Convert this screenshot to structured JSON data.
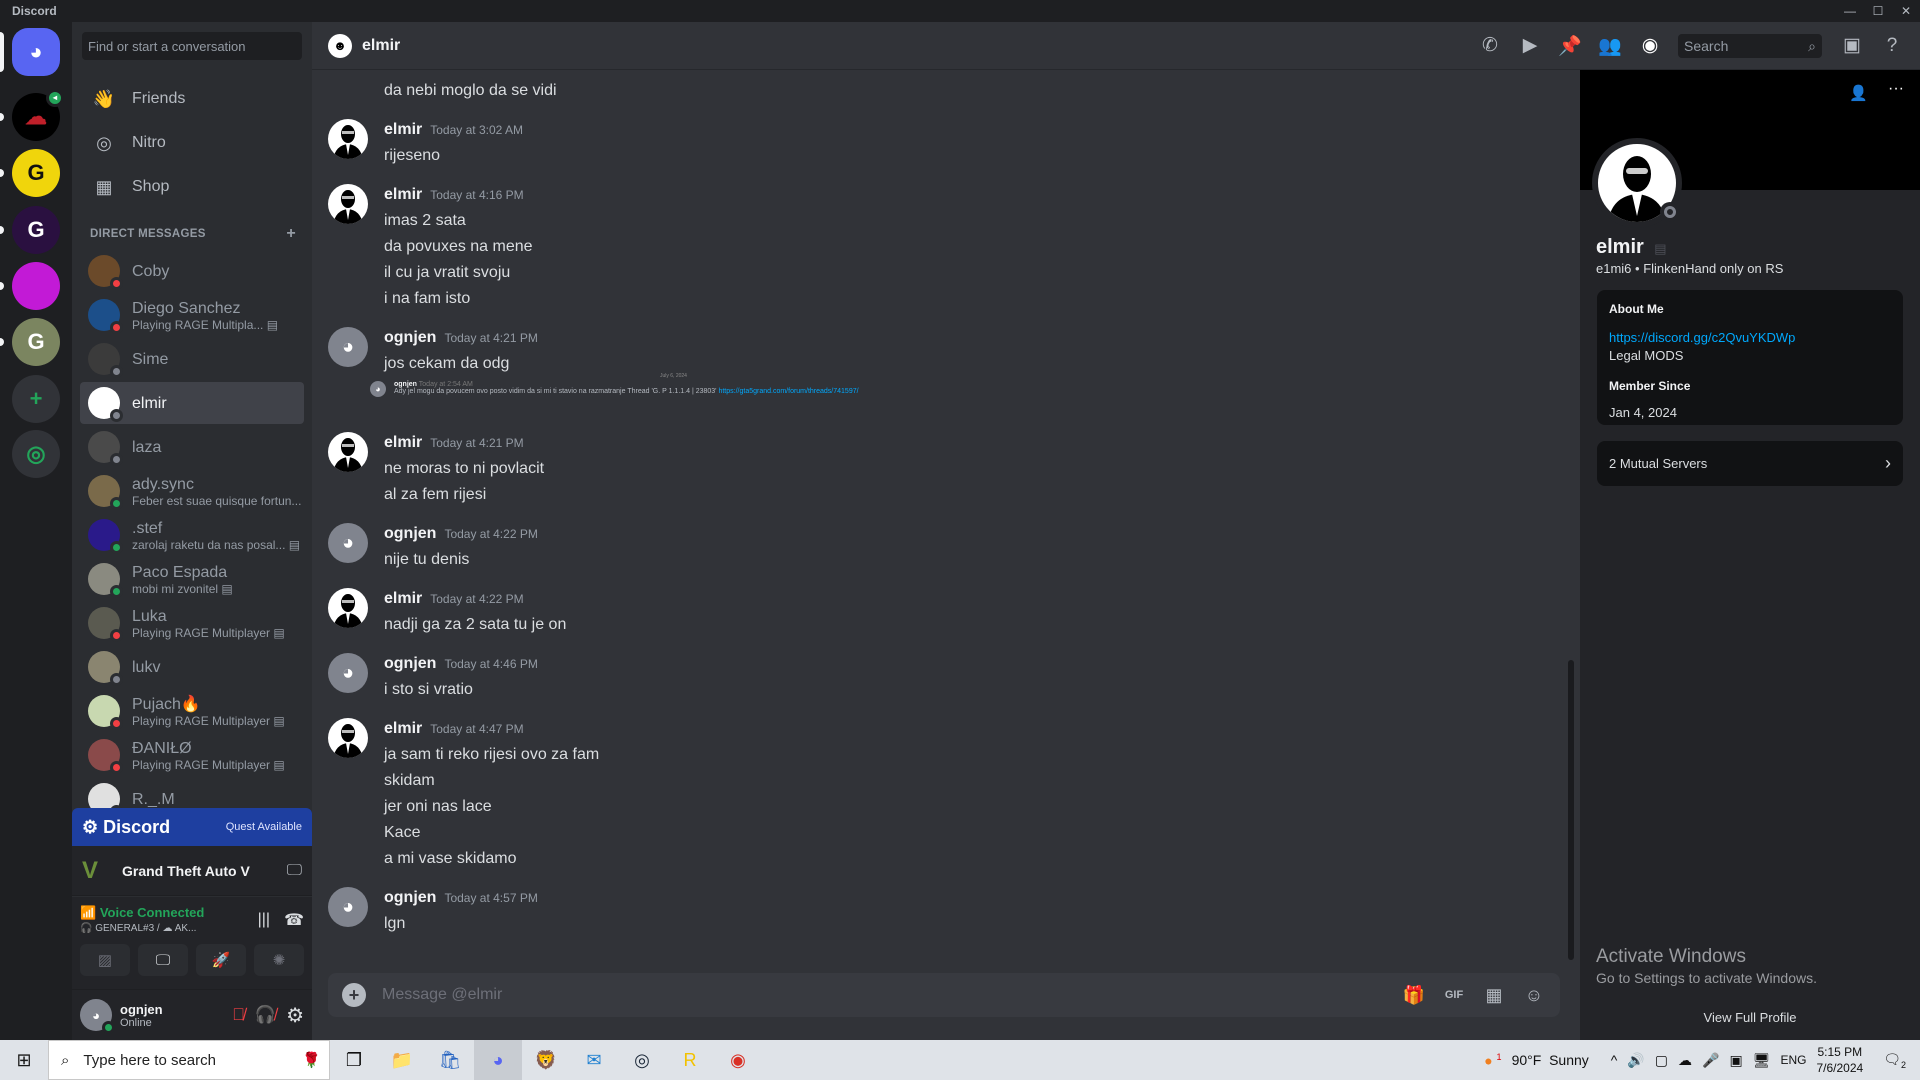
{
  "window": {
    "title": "Discord"
  },
  "colors": {
    "accent": "#5865f2",
    "online": "#23a55a",
    "dnd": "#f23f43",
    "offline": "#80848e",
    "link": "#00a8fc",
    "voice": "#23a55a",
    "quest": "#1e3fa0"
  },
  "servers": [
    {
      "icon": "discord-home-icon",
      "color": "#5865f2"
    },
    {
      "icon": "cloud-server-icon",
      "color": "#000000",
      "badge": "speaker-icon"
    },
    {
      "icon": "g-server-icon",
      "color": "#f0d50c"
    },
    {
      "icon": "g-server-icon",
      "color": "#2a1040"
    },
    {
      "icon": "purple-server-icon",
      "color": "#c21ad6"
    },
    {
      "icon": "g-server-icon",
      "color": "#7b8560"
    },
    {
      "icon": "add-server-icon",
      "color": "#313338"
    },
    {
      "icon": "discover-icon",
      "color": "#313338"
    }
  ],
  "sidebar": {
    "search_placeholder": "Find or start a conversation",
    "nav": [
      {
        "label": "Friends",
        "icon": "friends-icon"
      },
      {
        "label": "Nitro",
        "icon": "nitro-icon"
      },
      {
        "label": "Shop",
        "icon": "shop-icon"
      }
    ],
    "dm_header": "DIRECT MESSAGES",
    "dms": [
      {
        "name": "Coby",
        "status": "dnd",
        "color": "#6b4a2a"
      },
      {
        "name": "Diego Sanchez",
        "sub": "Playing RAGE Multipla...",
        "status": "dnd",
        "color": "#1c4f8a"
      },
      {
        "name": "Sime",
        "status": "offline",
        "color": "#3b3b3b"
      },
      {
        "name": "elmir",
        "status": "offline",
        "color": "#ffffff",
        "selected": true
      },
      {
        "name": "laza",
        "status": "offline",
        "color": "#4a4a4a"
      },
      {
        "name": "ady.sync",
        "sub": "Feber est suae quisque fortun...",
        "status": "online",
        "color": "#7a6a4a"
      },
      {
        "name": ".stef",
        "sub": "zarolaj raketu da nas posal...",
        "status": "online",
        "color": "#2a1a8a"
      },
      {
        "name": "Paco Espada",
        "sub": "mobi mi zvonitel",
        "status": "online",
        "color": "#8a8a80"
      },
      {
        "name": "Luka",
        "sub": "Playing RAGE Multiplayer",
        "status": "dnd",
        "color": "#5a5a50"
      },
      {
        "name": "lukv",
        "status": "offline",
        "color": "#8a8570"
      },
      {
        "name": "Pujach🔥",
        "sub": "Playing RAGE Multiplayer",
        "status": "dnd",
        "color": "#c8d8b0"
      },
      {
        "name": "ĐANIŁØ",
        "sub": "Playing RAGE Multiplayer",
        "status": "dnd",
        "color": "#8a4a4a"
      },
      {
        "name": "R._.M",
        "status": "dnd",
        "color": "#e0e0e0"
      }
    ],
    "quest": {
      "logo": "Discord",
      "label": "Quest Available"
    },
    "game": {
      "name": "Grand Theft Auto V"
    },
    "voice": {
      "status": "Voice Connected",
      "channel": "GENERAL#3 / ☁ AK..."
    },
    "user": {
      "name": "ognjen",
      "status": "Online"
    }
  },
  "header": {
    "name": "elmir",
    "search_placeholder": "Search",
    "icons": [
      "voice-call-icon",
      "video-call-icon",
      "pin-icon",
      "add-friend-icon",
      "user-profile-icon",
      "inbox-icon",
      "help-icon"
    ]
  },
  "messages": {
    "partial_line": "da nebi moglo da se vidi",
    "groups": [
      {
        "author": "elmir",
        "time": "Today at 3:02 AM",
        "lines": [
          "rijeseno"
        ]
      },
      {
        "author": "elmir",
        "time": "Today at 4:16 PM",
        "lines": [
          "imas 2 sata",
          "da povuxes na mene",
          "il cu ja vratit svoju",
          "i na fam isto"
        ]
      },
      {
        "author": "ognjen",
        "time": "Today at 4:21 PM",
        "lines": [
          "jos cekam da odg"
        ],
        "embed": {
          "date": "July 6, 2024",
          "author": "ognjen",
          "time": "Today at 2:54 AM",
          "text": "Ady jel mogu da povucem ovo posto vidim da si mi ti stavio na razmatranje Thread 'G. P 1.1.1.4 | 23803'",
          "link": "https://gta5grand.com/forum/threads/741597/"
        }
      },
      {
        "author": "elmir",
        "time": "Today at 4:21 PM",
        "lines": [
          "ne moras to ni povlacit",
          "al za fem rijesi"
        ]
      },
      {
        "author": "ognjen",
        "time": "Today at 4:22 PM",
        "lines": [
          "nije tu denis"
        ]
      },
      {
        "author": "elmir",
        "time": "Today at 4:22 PM",
        "lines": [
          "nadji ga za 2 sata tu je on"
        ]
      },
      {
        "author": "ognjen",
        "time": "Today at 4:46 PM",
        "lines": [
          "i sto si vratio"
        ]
      },
      {
        "author": "elmir",
        "time": "Today at 4:47 PM",
        "lines": [
          "ja sam ti reko rijesi ovo za fam",
          "skidam",
          "jer oni nas lace",
          "Kace",
          "a mi vase skidamo"
        ]
      },
      {
        "author": "ognjen",
        "time": "Today at 4:57 PM",
        "lines": [
          "lgn"
        ]
      }
    ]
  },
  "composer": {
    "placeholder": "Message @elmir"
  },
  "profile": {
    "display_name": "elmir",
    "username": "e1mi6",
    "tagline": "FlinkenHand only on RS",
    "about_label": "About Me",
    "about_link": "https://discord.gg/c2QvuYKDWp",
    "about_text": "Legal MODS",
    "member_since_label": "Member Since",
    "member_since": "Jan 4, 2024",
    "mutual": "2 Mutual Servers",
    "view_full": "View Full Profile"
  },
  "watermark": {
    "title": "Activate Windows",
    "sub": "Go to Settings to activate Windows."
  },
  "taskbar": {
    "search_placeholder": "Type here to search",
    "weather": "90°F  Sunny",
    "weather_badge": "1",
    "lang": "ENG",
    "time": "5:15 PM",
    "date": "7/6/2024",
    "notifications": "2"
  }
}
